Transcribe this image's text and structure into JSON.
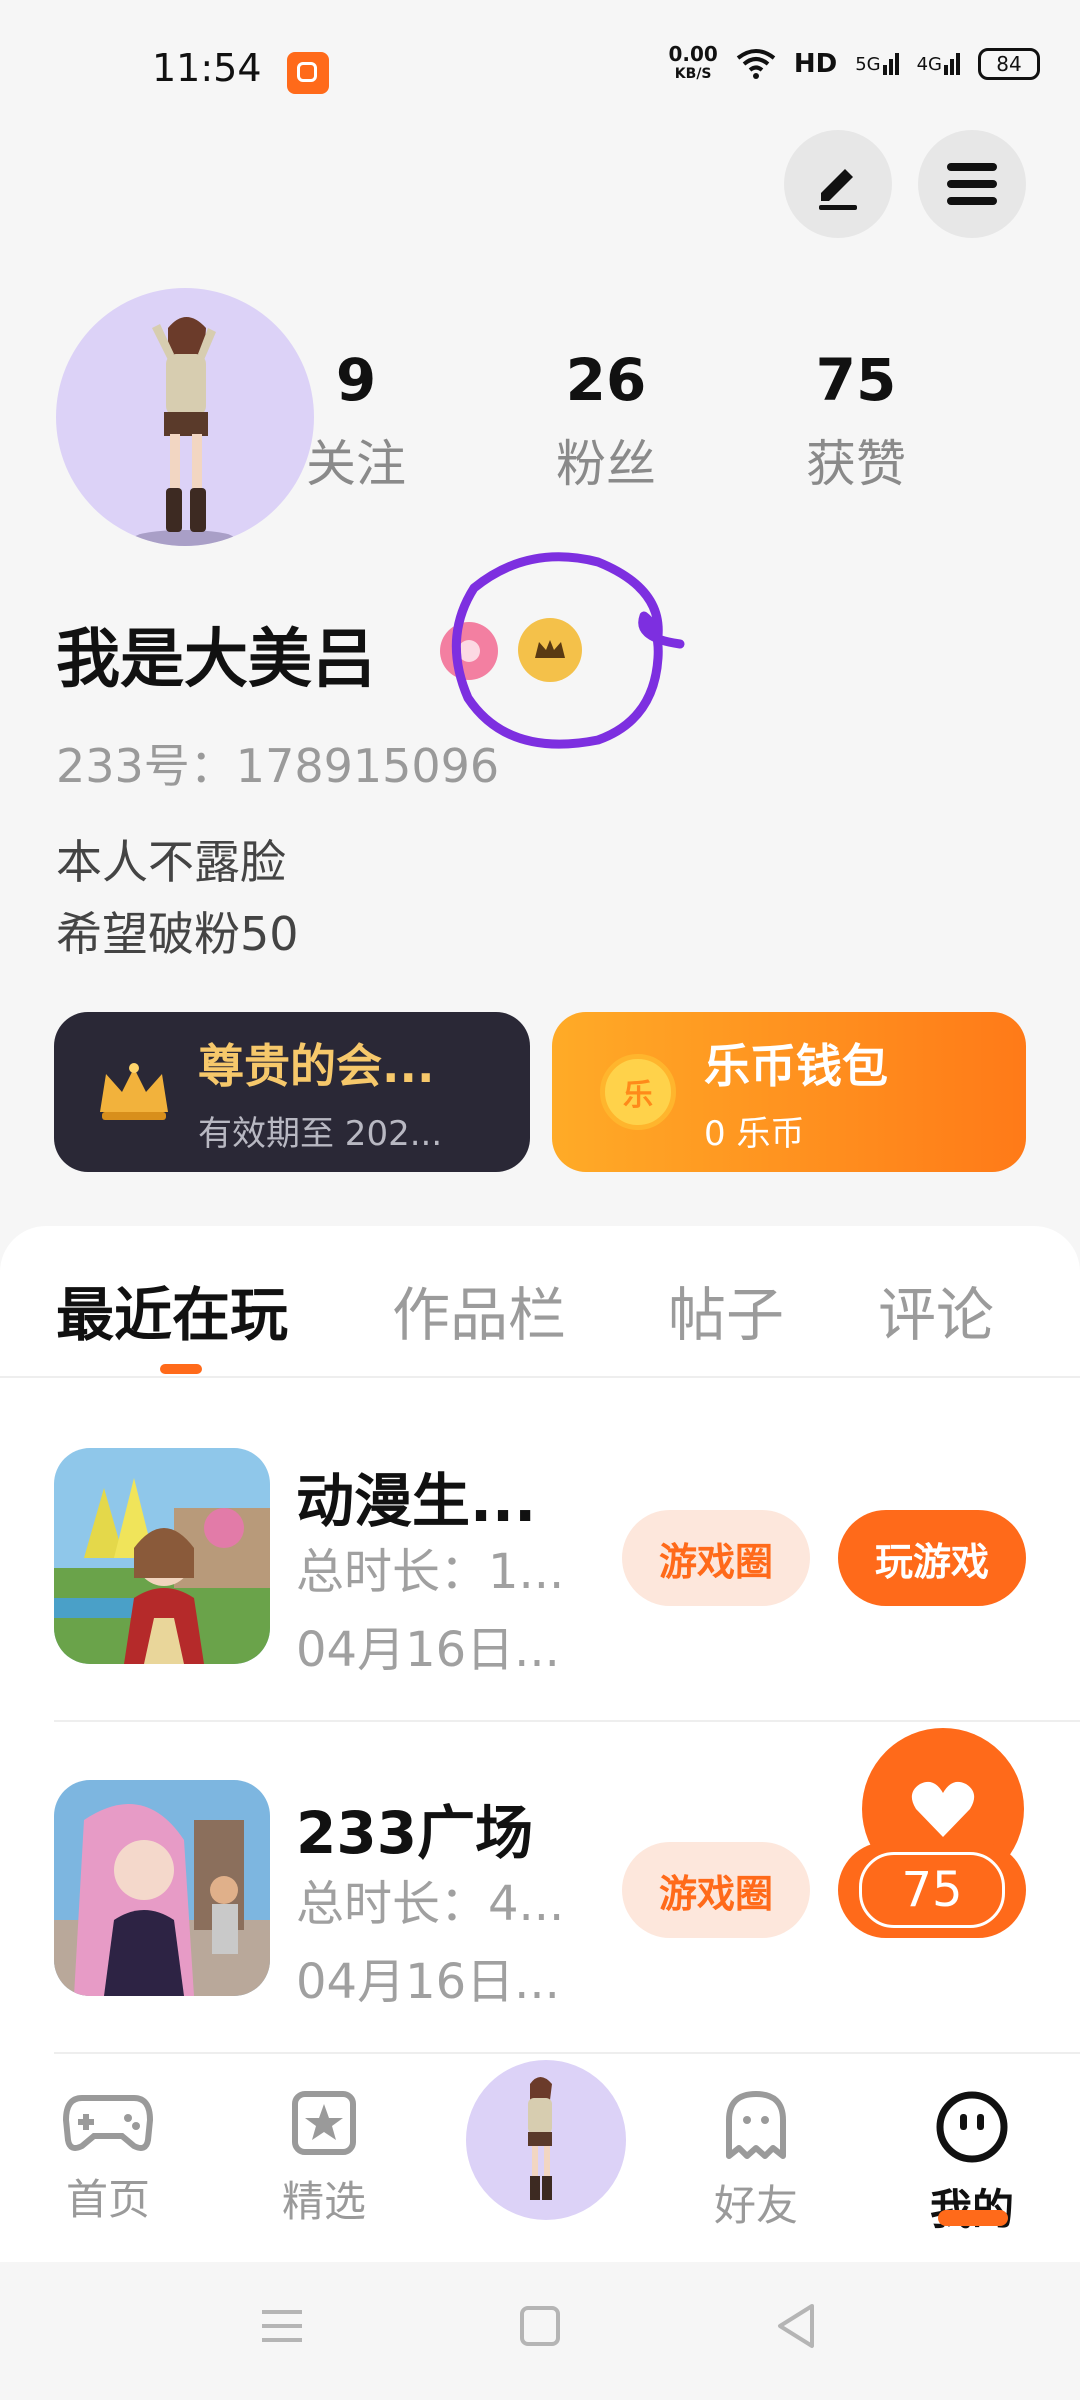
{
  "status_bar": {
    "time": "11:54",
    "net_speed_value": "0.00",
    "net_speed_unit": "KB/S",
    "hd_label": "HD",
    "signal_1": "5G",
    "signal_2": "4G",
    "battery": "84"
  },
  "profile": {
    "stats": [
      {
        "value": "9",
        "label": "关注"
      },
      {
        "value": "26",
        "label": "粉丝"
      },
      {
        "value": "75",
        "label": "获赞"
      }
    ],
    "nickname": "我是大美吕",
    "uid": "233号：178915096",
    "bio_line_1": "本人不露脸",
    "bio_line_2": "希望破粉50"
  },
  "cards": {
    "vip_title": "尊贵的会...",
    "vip_subtitle": "有效期至 202...",
    "wallet_title": "乐币钱包",
    "wallet_balance": "0 乐币",
    "coin_glyph": "乐"
  },
  "tabs": [
    "最近在玩",
    "作品栏",
    "帖子",
    "评论"
  ],
  "games": [
    {
      "title": "动漫生...",
      "duration": "总时长：1...",
      "date": "04月16日...",
      "circle_label": "游戏圈",
      "play_label": "玩游戏"
    },
    {
      "title": "233广场",
      "duration": "总时长：4...",
      "date": "04月16日...",
      "circle_label": "游戏圈"
    }
  ],
  "like_widget": {
    "count": "75"
  },
  "bottom_nav": {
    "home": "首页",
    "featured": "精选",
    "friends": "好友",
    "me": "我的"
  },
  "colors": {
    "accent": "#ff6a1a",
    "vip_card": "#2a2836",
    "avatar_bg": "#dcd2f7",
    "annotation": "#7d2fe0"
  }
}
